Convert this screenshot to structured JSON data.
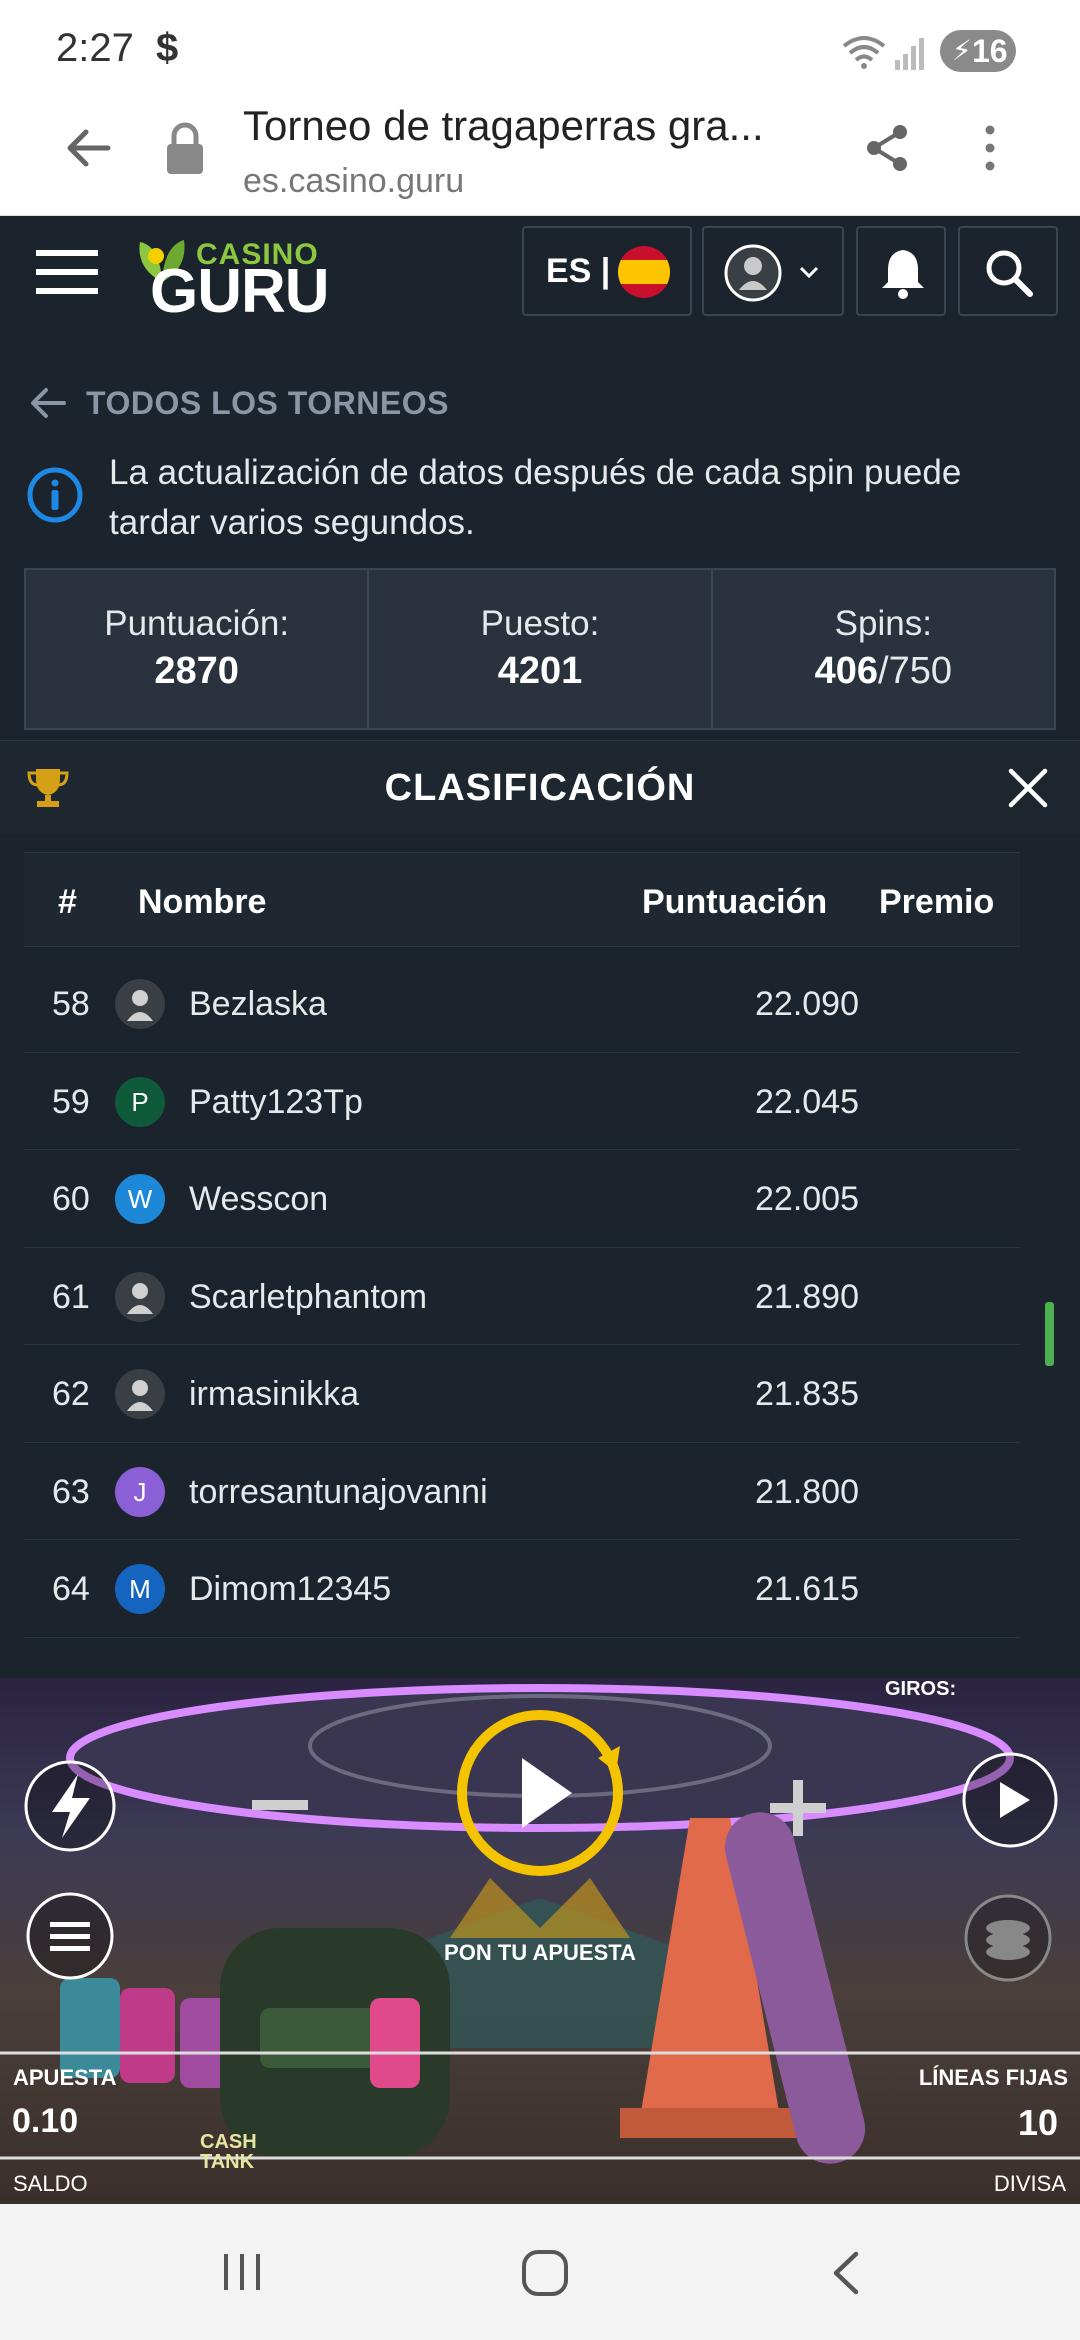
{
  "status_bar": {
    "time": "2:27",
    "dollar": "$",
    "battery": "16"
  },
  "browser": {
    "title": "Torneo de tragaperras gra...",
    "url": "es.casino.guru"
  },
  "site_header": {
    "logo_top": "CASINO",
    "logo_bottom": "GURU",
    "language": "ES |"
  },
  "tournament": {
    "back_label": "TODOS LOS TORNEOS",
    "info_message": "La actualización de datos después de cada spin puede tardar varios segundos.",
    "stats": {
      "score_label": "Puntuación:",
      "score_value": "2870",
      "rank_label": "Puesto:",
      "rank_value": "4201",
      "spins_label": "Spins:",
      "spins_used": "406",
      "spins_total": "/750"
    },
    "leaderboard_title": "CLASIFICACIÓN"
  },
  "table": {
    "headers": {
      "rank": "#",
      "name": "Nombre",
      "score": "Puntuación",
      "prize": "Premio"
    },
    "rows": [
      {
        "rank": "58",
        "avatar": "",
        "avatar_color": "#3a3f45",
        "name": "Bezlaska",
        "score": "22.090"
      },
      {
        "rank": "59",
        "avatar": "P",
        "avatar_color": "#0e5a3a",
        "name": "Patty123Tp",
        "score": "22.045"
      },
      {
        "rank": "60",
        "avatar": "W",
        "avatar_color": "#1e88d8",
        "name": "Wesscon",
        "score": "22.005"
      },
      {
        "rank": "61",
        "avatar": "",
        "avatar_color": "#3a3f45",
        "name": "Scarletphantom",
        "score": "21.890"
      },
      {
        "rank": "62",
        "avatar": "",
        "avatar_color": "#3a3f45",
        "name": "irmasinikka",
        "score": "21.835"
      },
      {
        "rank": "63",
        "avatar": "J",
        "avatar_color": "#8b5fd6",
        "name": "torresantunajovanni",
        "score": "21.800"
      },
      {
        "rank": "64",
        "avatar": "M",
        "avatar_color": "#1565c0",
        "name": "Dimom12345",
        "score": "21.615"
      }
    ]
  },
  "game": {
    "spins_label": "GIROS:",
    "place_bet": "PON TU APUESTA",
    "bet_label": "APUESTA",
    "bet_value": "0.10",
    "lines_label": "LÍNEAS FIJAS",
    "lines_value": "10",
    "balance_label": "SALDO",
    "currency_label": "DIVISA",
    "bag_text": "CASH TANK"
  },
  "icons": [
    "menu-icon",
    "flag-es-icon",
    "user-icon",
    "chevron-down-icon",
    "bell-icon",
    "search-icon",
    "back-arrow-icon",
    "lock-icon",
    "share-icon",
    "more-icon",
    "info-icon",
    "trophy-icon",
    "close-icon"
  ],
  "colors": {
    "bg": "#1b232c",
    "accent_green": "#8dc63f",
    "info_blue": "#1e88e5",
    "trophy_gold": "#d4a017"
  }
}
